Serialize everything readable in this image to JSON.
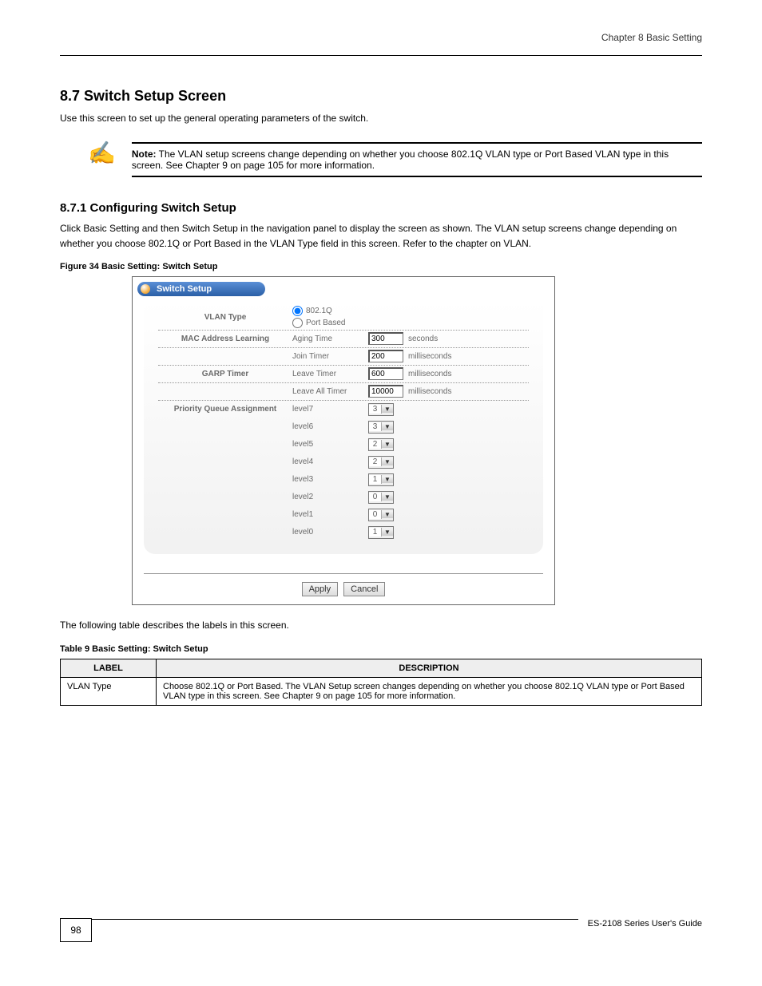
{
  "header": {
    "right_text": "Chapter 8 Basic Setting"
  },
  "section": {
    "heading": "8.7  Switch Setup Screen",
    "para1": "Use this screen to set up the general operating parameters of the switch.",
    "note_label": "Note:",
    "note_text": "The VLAN setup screens change depending on whether you choose 802.1Q VLAN type or Port Based VLAN type in this screen. See Chapter 9 on page 105 for more information."
  },
  "subsection": {
    "heading": "8.7.1  Configuring Switch Setup",
    "para": "Click Basic Setting and then Switch Setup in the navigation panel to display the screen as shown. The VLAN setup screens change depending on whether you choose 802.1Q or Port Based in the VLAN Type field in this screen. Refer to the chapter on VLAN.",
    "figure_caption": "Figure 34   Basic Setting: Switch Setup"
  },
  "panel": {
    "title": "Switch Setup",
    "vlan_type_label": "VLAN Type",
    "vlan_opt1": "802.1Q",
    "vlan_opt2": "Port Based",
    "mac_label": "MAC Address Learning",
    "aging_label": "Aging Time",
    "aging_value": "300",
    "aging_unit": "seconds",
    "garp_label": "GARP Timer",
    "join_label": "Join Timer",
    "join_value": "200",
    "join_unit": "milliseconds",
    "leave_label": "Leave Timer",
    "leave_value": "600",
    "leave_unit": "milliseconds",
    "leaveall_label": "Leave All Timer",
    "leaveall_value": "10000",
    "leaveall_unit": "milliseconds",
    "pq_label": "Priority Queue Assignment",
    "levels": [
      {
        "name": "level7",
        "val": "3"
      },
      {
        "name": "level6",
        "val": "3"
      },
      {
        "name": "level5",
        "val": "2"
      },
      {
        "name": "level4",
        "val": "2"
      },
      {
        "name": "level3",
        "val": "1"
      },
      {
        "name": "level2",
        "val": "0"
      },
      {
        "name": "level1",
        "val": "0"
      },
      {
        "name": "level0",
        "val": "1"
      }
    ],
    "apply": "Apply",
    "cancel": "Cancel"
  },
  "table": {
    "caption": "Table 9   Basic Setting: Switch Setup",
    "head_label": "LABEL",
    "head_desc": "DESCRIPTION",
    "row_label": "VLAN Type",
    "row_desc": "Choose 802.1Q or Port Based. The VLAN Setup screen changes depending on whether you choose 802.1Q VLAN type or Port Based VLAN type in this screen. See Chapter 9 on page 105 for more information."
  },
  "footer": {
    "page_no": "98",
    "text": "ES-2108 Series User's Guide"
  }
}
